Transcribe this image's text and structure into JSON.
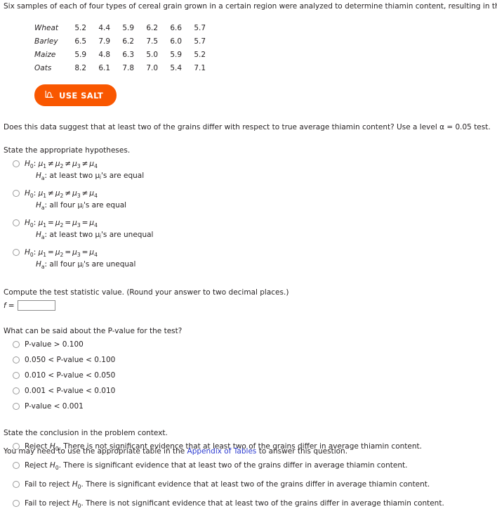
{
  "intro": "Six samples of each of four types of cereal grain grown in a certain region were analyzed to determine thiamin content, resulting in the following data (µg/g).",
  "data_table": {
    "rows": [
      {
        "grain": "Wheat",
        "values": [
          "5.2",
          "4.4",
          "5.9",
          "6.2",
          "6.6",
          "5.7"
        ]
      },
      {
        "grain": "Barley",
        "values": [
          "6.5",
          "7.9",
          "6.2",
          "7.5",
          "6.0",
          "5.7"
        ]
      },
      {
        "grain": "Maize",
        "values": [
          "5.9",
          "4.8",
          "6.3",
          "5.0",
          "5.9",
          "5.2"
        ]
      },
      {
        "grain": "Oats",
        "values": [
          "8.2",
          "6.1",
          "7.8",
          "7.0",
          "5.4",
          "7.1"
        ]
      }
    ]
  },
  "salt_button": {
    "label": "USE SALT",
    "icon": "distribution-curve-icon",
    "color": "#f95700"
  },
  "question_level": "Does this data suggest that at least two of the grains differ with respect to true average thiamin content? Use a level α = 0.05 test.",
  "hypotheses": {
    "prompt": "State the appropriate hypotheses.",
    "options": [
      {
        "null_relation": "≠",
        "alt": "at least two μⱼ's are equal"
      },
      {
        "null_relation": "≠",
        "alt": "all four μⱼ's are equal"
      },
      {
        "null_relation": "=",
        "alt": "at least two μⱼ's are unequal"
      },
      {
        "null_relation": "=",
        "alt": "all four μⱼ's are unequal"
      }
    ]
  },
  "test_statistic": {
    "prompt": "Compute the test statistic value. (Round your answer to two decimal places.)",
    "label": "f",
    "equals": "=",
    "value": "",
    "placeholder": ""
  },
  "pvalue": {
    "prompt": "What can be said about the P-value for the test?",
    "options": [
      "P-value > 0.100",
      "0.050 < P-value < 0.100",
      "0.010 < P-value < 0.050",
      "0.001 < P-value < 0.010",
      "P-value < 0.001"
    ]
  },
  "conclusion": {
    "prompt": "State the conclusion in the problem context.",
    "options": [
      {
        "decision": "Reject",
        "sentence": ". There is not significant evidence that at least two of the grains differ in average thiamin content."
      },
      {
        "decision": "Reject",
        "sentence": ". There is significant evidence that at least two of the grains differ in average thiamin content."
      },
      {
        "decision": "Fail to reject",
        "sentence": ". There is significant evidence that at least two of the grains differ in average thiamin content."
      },
      {
        "decision": "Fail to reject",
        "sentence": ". There is not significant evidence that at least two of the grains differ in average thiamin content."
      }
    ]
  },
  "footer": {
    "before": "You may need to use the appropriate table in the ",
    "link": "Appendix of Tables",
    "after": " to answer this question."
  }
}
